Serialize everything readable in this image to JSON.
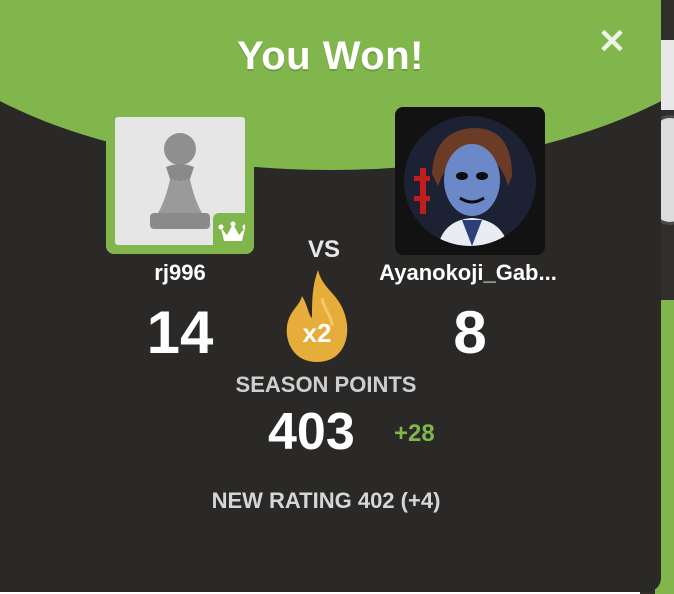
{
  "modal": {
    "title": "You Won!",
    "close_label": "✕"
  },
  "players": {
    "left": {
      "name": "rj996",
      "score": "14",
      "avatar": "pawn-icon",
      "badge": "crown-icon"
    },
    "right": {
      "name": "Ayanokoji_Gab...",
      "score": "8",
      "avatar": "profile-picture"
    }
  },
  "vs_label": "VS",
  "multiplier": {
    "label": "x2",
    "icon": "flame-icon"
  },
  "season": {
    "label": "SEASON POINTS",
    "value": "403",
    "delta": "+28"
  },
  "rating_text": "NEW RATING 402 (+4)",
  "colors": {
    "green": "#81b64c",
    "dark": "#2a2927",
    "flame": "#e6ad3a"
  }
}
